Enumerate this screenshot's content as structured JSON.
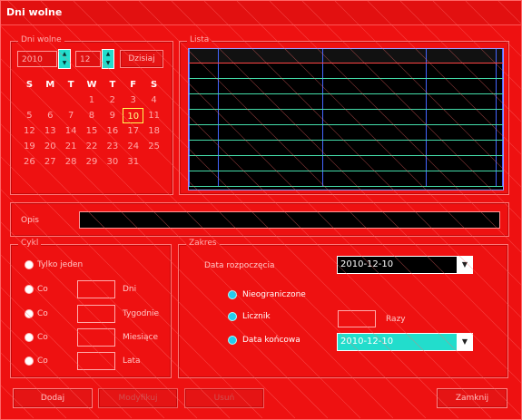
{
  "window": {
    "title": "Dni wolne"
  },
  "date_section": {
    "legend": "Dni wolne",
    "year": "2010",
    "month": "12",
    "today_button": "Dzisiaj",
    "weekdays": [
      "S",
      "M",
      "T",
      "W",
      "T",
      "F",
      "S"
    ],
    "weeks": [
      [
        "",
        "",
        "",
        "1",
        "2",
        "3",
        "4"
      ],
      [
        "5",
        "6",
        "7",
        "8",
        "9",
        "10",
        "11"
      ],
      [
        "12",
        "13",
        "14",
        "15",
        "16",
        "17",
        "18"
      ],
      [
        "19",
        "20",
        "21",
        "22",
        "23",
        "24",
        "25"
      ],
      [
        "26",
        "27",
        "28",
        "29",
        "30",
        "31",
        ""
      ]
    ],
    "selected_day": "10"
  },
  "list_section": {
    "legend": "Lista",
    "columns": [
      "",
      "",
      "",
      "",
      ""
    ],
    "row_count": 8
  },
  "description": {
    "label": "Opis",
    "value": ""
  },
  "cycle_section": {
    "legend": "Cykl",
    "options": [
      {
        "label": "Tylko jeden",
        "unit": ""
      },
      {
        "label": "Co",
        "unit": "Dni"
      },
      {
        "label": "Co",
        "unit": "Tygodnie"
      },
      {
        "label": "Co",
        "unit": "Miesiące"
      },
      {
        "label": "Co",
        "unit": "Lata"
      }
    ]
  },
  "range_section": {
    "legend": "Zakres",
    "start_label": "Data rozpoczęcia",
    "start_value": "2010-12-10",
    "unlimited_label": "Nieograniczone",
    "counter_label": "Licznik",
    "counter_unit": "Razy",
    "end_label": "Data końcowa",
    "end_value": "2010-12-10"
  },
  "footer": {
    "add_button": "Dodaj",
    "modify_button": "Modyfikuj",
    "delete_button": "Usuń",
    "close_button": "Zamknij"
  },
  "colors": {
    "background": "#ee1111",
    "list_bg": "#000000",
    "accent": "#22ddcc"
  }
}
